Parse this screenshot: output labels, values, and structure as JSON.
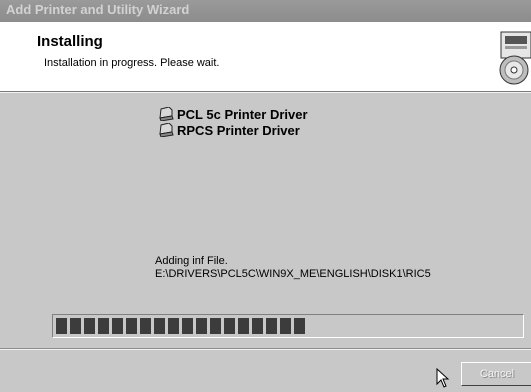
{
  "window": {
    "title": "Add Printer and Utility Wizard"
  },
  "header": {
    "title": "Installing",
    "subtitle": "Installation in progress. Please wait.",
    "icon": "printer-cd-icon"
  },
  "drivers": [
    {
      "label": "PCL 5c Printer Driver",
      "icon": "printer-icon"
    },
    {
      "label": "RPCS Printer Driver",
      "icon": "printer-icon"
    }
  ],
  "status": {
    "action": "Adding inf File.",
    "path": "E:\\DRIVERS\\PCL5C\\WIN9X_ME\\ENGLISH\\DISK1\\RIC5"
  },
  "progress": {
    "fraction": 0.54
  },
  "buttons": {
    "cancel_label": "Cancel",
    "cancel_enabled": false
  }
}
